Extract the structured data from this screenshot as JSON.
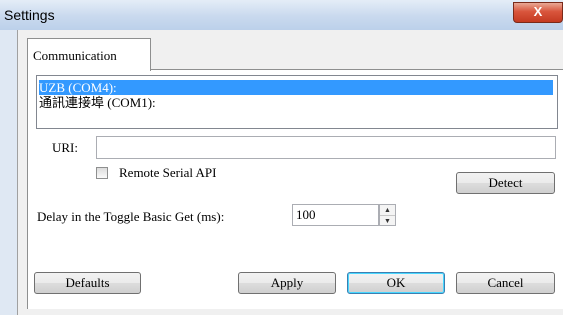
{
  "window": {
    "title": "Settings",
    "close_glyph": "X"
  },
  "tabs": [
    {
      "label": "Communication"
    }
  ],
  "ports": [
    {
      "label": "UZB (COM4):",
      "selected": true
    },
    {
      "label": "通訊連接埠 (COM1):",
      "selected": false
    }
  ],
  "uri": {
    "label": "URI:",
    "value": ""
  },
  "remote_serial": {
    "label": "Remote Serial API",
    "checked": false
  },
  "detect_label": "Detect",
  "delay": {
    "label": "Delay in the Toggle Basic Get (ms):",
    "value": "100"
  },
  "buttons": {
    "defaults": "Defaults",
    "apply": "Apply",
    "ok": "OK",
    "cancel": "Cancel"
  },
  "colors": {
    "selection": "#3399ff",
    "title_gradient_top": "#e4edf7",
    "close_button": "#c43a22"
  }
}
